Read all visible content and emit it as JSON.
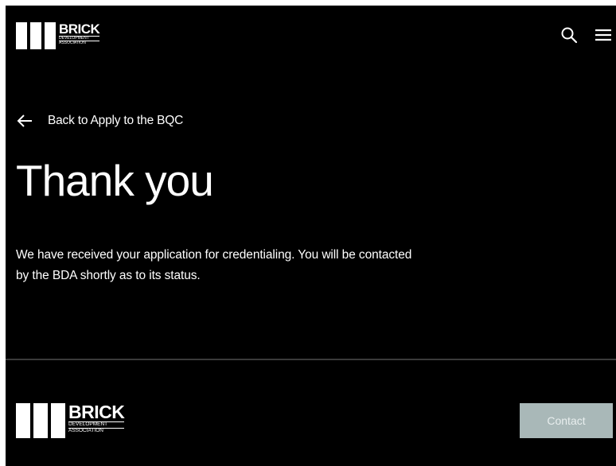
{
  "brand": {
    "name": "BRICK",
    "sub_line1": "DEVELOPMENT",
    "sub_line2": "ASSOCIATION"
  },
  "header": {
    "icons": [
      "search-icon",
      "hamburger-menu-icon"
    ]
  },
  "back_link": {
    "label": "Back to Apply to the BQC",
    "icon": "arrow-left-icon"
  },
  "main": {
    "title": "Thank you",
    "message_line1": "We have received your application for credentialing. You will be contacted",
    "message_line2": "by the BDA shortly as to its status."
  },
  "footer": {
    "contact_label": "Contact"
  },
  "colors": {
    "background": "#000000",
    "text": "#ffffff",
    "divider": "#3a3a3a",
    "contact_button_bg": "#a9b8b8"
  }
}
